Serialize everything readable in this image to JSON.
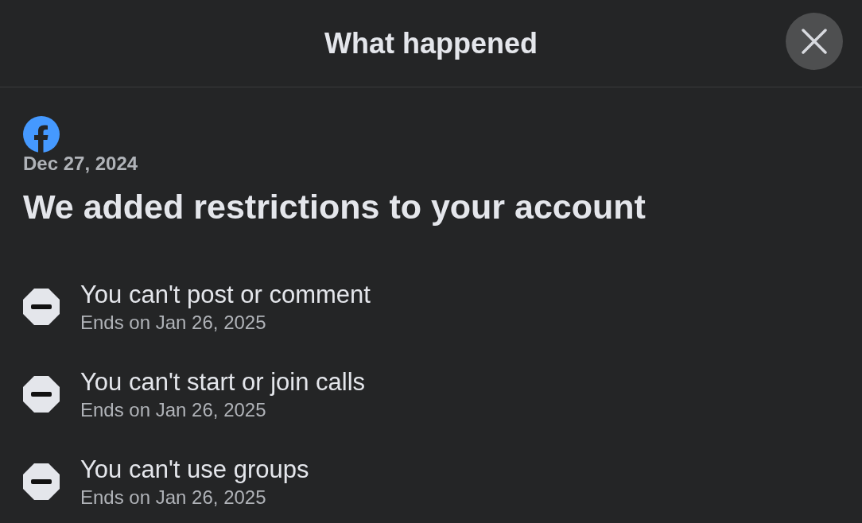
{
  "header": {
    "title": "What happened"
  },
  "notice": {
    "date": "Dec 27, 2024",
    "heading": "We added restrictions to your account"
  },
  "restrictions": [
    {
      "title": "You can't post or comment",
      "ends": "Ends on Jan 26, 2025"
    },
    {
      "title": "You can't start or join calls",
      "ends": "Ends on Jan 26, 2025"
    },
    {
      "title": "You can't use groups",
      "ends": "Ends on Jan 26, 2025"
    }
  ]
}
